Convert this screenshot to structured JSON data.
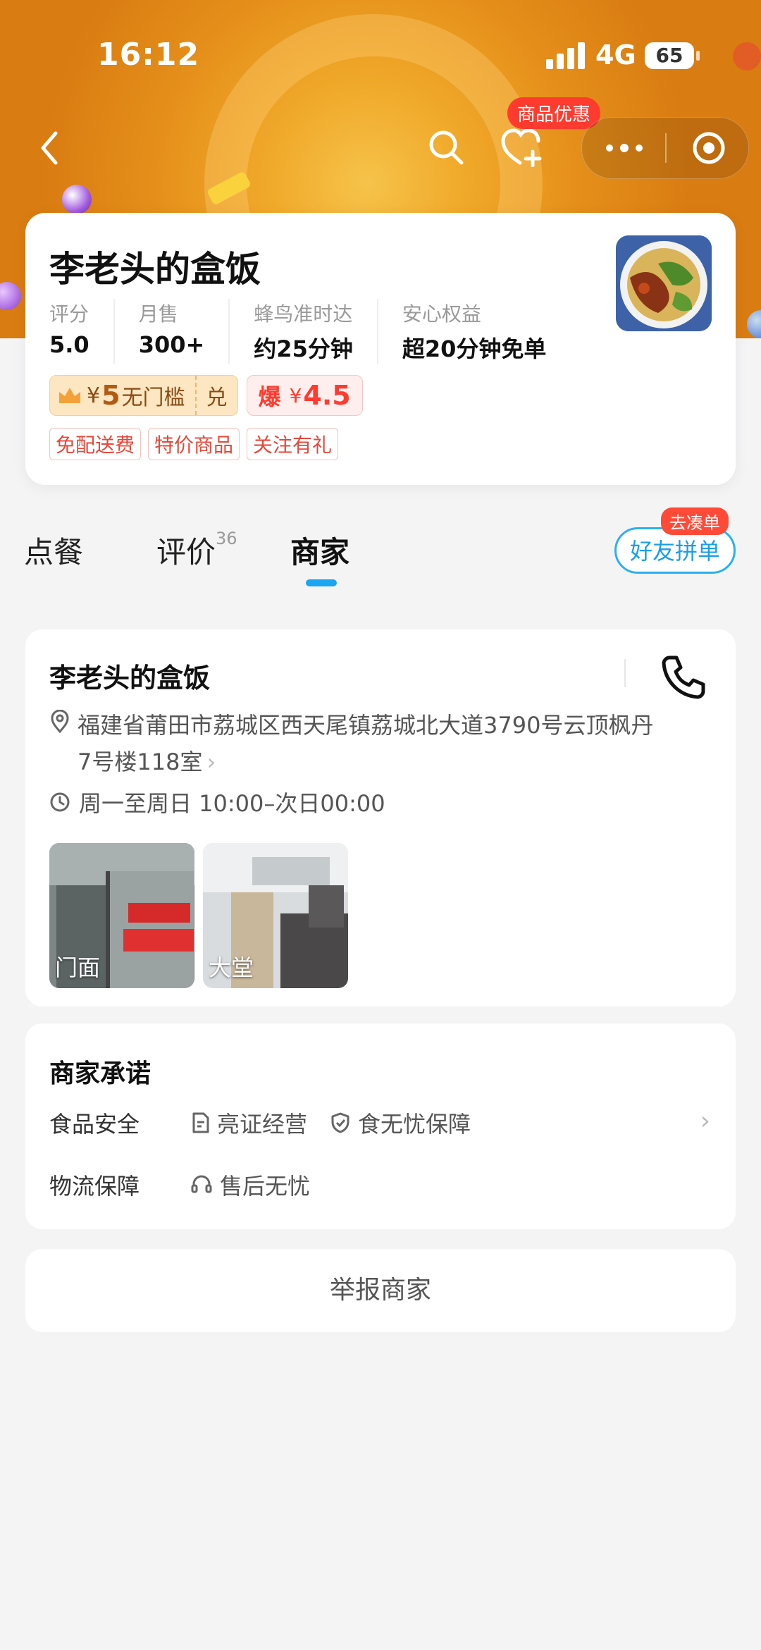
{
  "status_bar": {
    "time": "16:12",
    "network": "4G",
    "battery": "65"
  },
  "nav": {
    "promo_tag": "商品优惠"
  },
  "store": {
    "name": "李老头的盒饭",
    "stats": [
      {
        "label": "评分",
        "value": "5.0"
      },
      {
        "label": "月售",
        "value": "300+"
      },
      {
        "label": "蜂鸟准时达",
        "value": "约25分钟"
      },
      {
        "label": "安心权益",
        "value": "超20分钟免单"
      }
    ],
    "coupon_gold": {
      "currency": "¥",
      "amount": "5",
      "text": "无门槛",
      "exchange": "兑"
    },
    "coupon_red": {
      "prefix": "爆",
      "currency": "¥",
      "amount": "4.5"
    },
    "tags": [
      "免配送费",
      "特价商品",
      "关注有礼"
    ]
  },
  "tabs": [
    {
      "label": "点餐"
    },
    {
      "label": "评价",
      "count": "36"
    },
    {
      "label": "商家"
    }
  ],
  "group_order": {
    "label": "好友拼单",
    "tag": "去凑单"
  },
  "merchant": {
    "name": "李老头的盒饭",
    "address": "福建省莆田市荔城区西天尾镇荔城北大道3790号云顶枫丹7号楼118室",
    "hours": "周一至周日 10:00–次日00:00",
    "photos": [
      {
        "label": "门面"
      },
      {
        "label": "大堂"
      }
    ]
  },
  "promise": {
    "title": "商家承诺",
    "rows": [
      {
        "label": "食品安全",
        "items": [
          "亮证经营",
          "食无忧保障"
        ]
      },
      {
        "label": "物流保障",
        "items": [
          "售后无忧"
        ]
      }
    ]
  },
  "report": {
    "label": "举报商家"
  },
  "colors": {
    "accent_blue": "#1aa6f0",
    "brand_red": "#ff3b2f",
    "hero_orange": "#f0a92a"
  }
}
